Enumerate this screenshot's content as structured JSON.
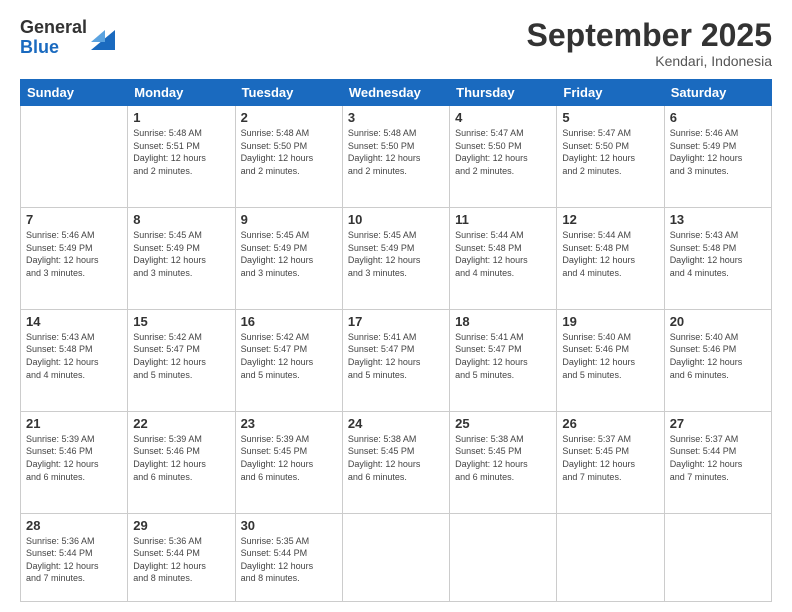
{
  "header": {
    "logo_general": "General",
    "logo_blue": "Blue",
    "month_title": "September 2025",
    "location": "Kendari, Indonesia"
  },
  "days_of_week": [
    "Sunday",
    "Monday",
    "Tuesday",
    "Wednesday",
    "Thursday",
    "Friday",
    "Saturday"
  ],
  "weeks": [
    [
      {
        "day": "",
        "info": ""
      },
      {
        "day": "1",
        "info": "Sunrise: 5:48 AM\nSunset: 5:51 PM\nDaylight: 12 hours\nand 2 minutes."
      },
      {
        "day": "2",
        "info": "Sunrise: 5:48 AM\nSunset: 5:50 PM\nDaylight: 12 hours\nand 2 minutes."
      },
      {
        "day": "3",
        "info": "Sunrise: 5:48 AM\nSunset: 5:50 PM\nDaylight: 12 hours\nand 2 minutes."
      },
      {
        "day": "4",
        "info": "Sunrise: 5:47 AM\nSunset: 5:50 PM\nDaylight: 12 hours\nand 2 minutes."
      },
      {
        "day": "5",
        "info": "Sunrise: 5:47 AM\nSunset: 5:50 PM\nDaylight: 12 hours\nand 2 minutes."
      },
      {
        "day": "6",
        "info": "Sunrise: 5:46 AM\nSunset: 5:49 PM\nDaylight: 12 hours\nand 3 minutes."
      }
    ],
    [
      {
        "day": "7",
        "info": "Sunrise: 5:46 AM\nSunset: 5:49 PM\nDaylight: 12 hours\nand 3 minutes."
      },
      {
        "day": "8",
        "info": "Sunrise: 5:45 AM\nSunset: 5:49 PM\nDaylight: 12 hours\nand 3 minutes."
      },
      {
        "day": "9",
        "info": "Sunrise: 5:45 AM\nSunset: 5:49 PM\nDaylight: 12 hours\nand 3 minutes."
      },
      {
        "day": "10",
        "info": "Sunrise: 5:45 AM\nSunset: 5:49 PM\nDaylight: 12 hours\nand 3 minutes."
      },
      {
        "day": "11",
        "info": "Sunrise: 5:44 AM\nSunset: 5:48 PM\nDaylight: 12 hours\nand 4 minutes."
      },
      {
        "day": "12",
        "info": "Sunrise: 5:44 AM\nSunset: 5:48 PM\nDaylight: 12 hours\nand 4 minutes."
      },
      {
        "day": "13",
        "info": "Sunrise: 5:43 AM\nSunset: 5:48 PM\nDaylight: 12 hours\nand 4 minutes."
      }
    ],
    [
      {
        "day": "14",
        "info": "Sunrise: 5:43 AM\nSunset: 5:48 PM\nDaylight: 12 hours\nand 4 minutes."
      },
      {
        "day": "15",
        "info": "Sunrise: 5:42 AM\nSunset: 5:47 PM\nDaylight: 12 hours\nand 5 minutes."
      },
      {
        "day": "16",
        "info": "Sunrise: 5:42 AM\nSunset: 5:47 PM\nDaylight: 12 hours\nand 5 minutes."
      },
      {
        "day": "17",
        "info": "Sunrise: 5:41 AM\nSunset: 5:47 PM\nDaylight: 12 hours\nand 5 minutes."
      },
      {
        "day": "18",
        "info": "Sunrise: 5:41 AM\nSunset: 5:47 PM\nDaylight: 12 hours\nand 5 minutes."
      },
      {
        "day": "19",
        "info": "Sunrise: 5:40 AM\nSunset: 5:46 PM\nDaylight: 12 hours\nand 5 minutes."
      },
      {
        "day": "20",
        "info": "Sunrise: 5:40 AM\nSunset: 5:46 PM\nDaylight: 12 hours\nand 6 minutes."
      }
    ],
    [
      {
        "day": "21",
        "info": "Sunrise: 5:39 AM\nSunset: 5:46 PM\nDaylight: 12 hours\nand 6 minutes."
      },
      {
        "day": "22",
        "info": "Sunrise: 5:39 AM\nSunset: 5:46 PM\nDaylight: 12 hours\nand 6 minutes."
      },
      {
        "day": "23",
        "info": "Sunrise: 5:39 AM\nSunset: 5:45 PM\nDaylight: 12 hours\nand 6 minutes."
      },
      {
        "day": "24",
        "info": "Sunrise: 5:38 AM\nSunset: 5:45 PM\nDaylight: 12 hours\nand 6 minutes."
      },
      {
        "day": "25",
        "info": "Sunrise: 5:38 AM\nSunset: 5:45 PM\nDaylight: 12 hours\nand 6 minutes."
      },
      {
        "day": "26",
        "info": "Sunrise: 5:37 AM\nSunset: 5:45 PM\nDaylight: 12 hours\nand 7 minutes."
      },
      {
        "day": "27",
        "info": "Sunrise: 5:37 AM\nSunset: 5:44 PM\nDaylight: 12 hours\nand 7 minutes."
      }
    ],
    [
      {
        "day": "28",
        "info": "Sunrise: 5:36 AM\nSunset: 5:44 PM\nDaylight: 12 hours\nand 7 minutes."
      },
      {
        "day": "29",
        "info": "Sunrise: 5:36 AM\nSunset: 5:44 PM\nDaylight: 12 hours\nand 8 minutes."
      },
      {
        "day": "30",
        "info": "Sunrise: 5:35 AM\nSunset: 5:44 PM\nDaylight: 12 hours\nand 8 minutes."
      },
      {
        "day": "",
        "info": ""
      },
      {
        "day": "",
        "info": ""
      },
      {
        "day": "",
        "info": ""
      },
      {
        "day": "",
        "info": ""
      }
    ]
  ]
}
